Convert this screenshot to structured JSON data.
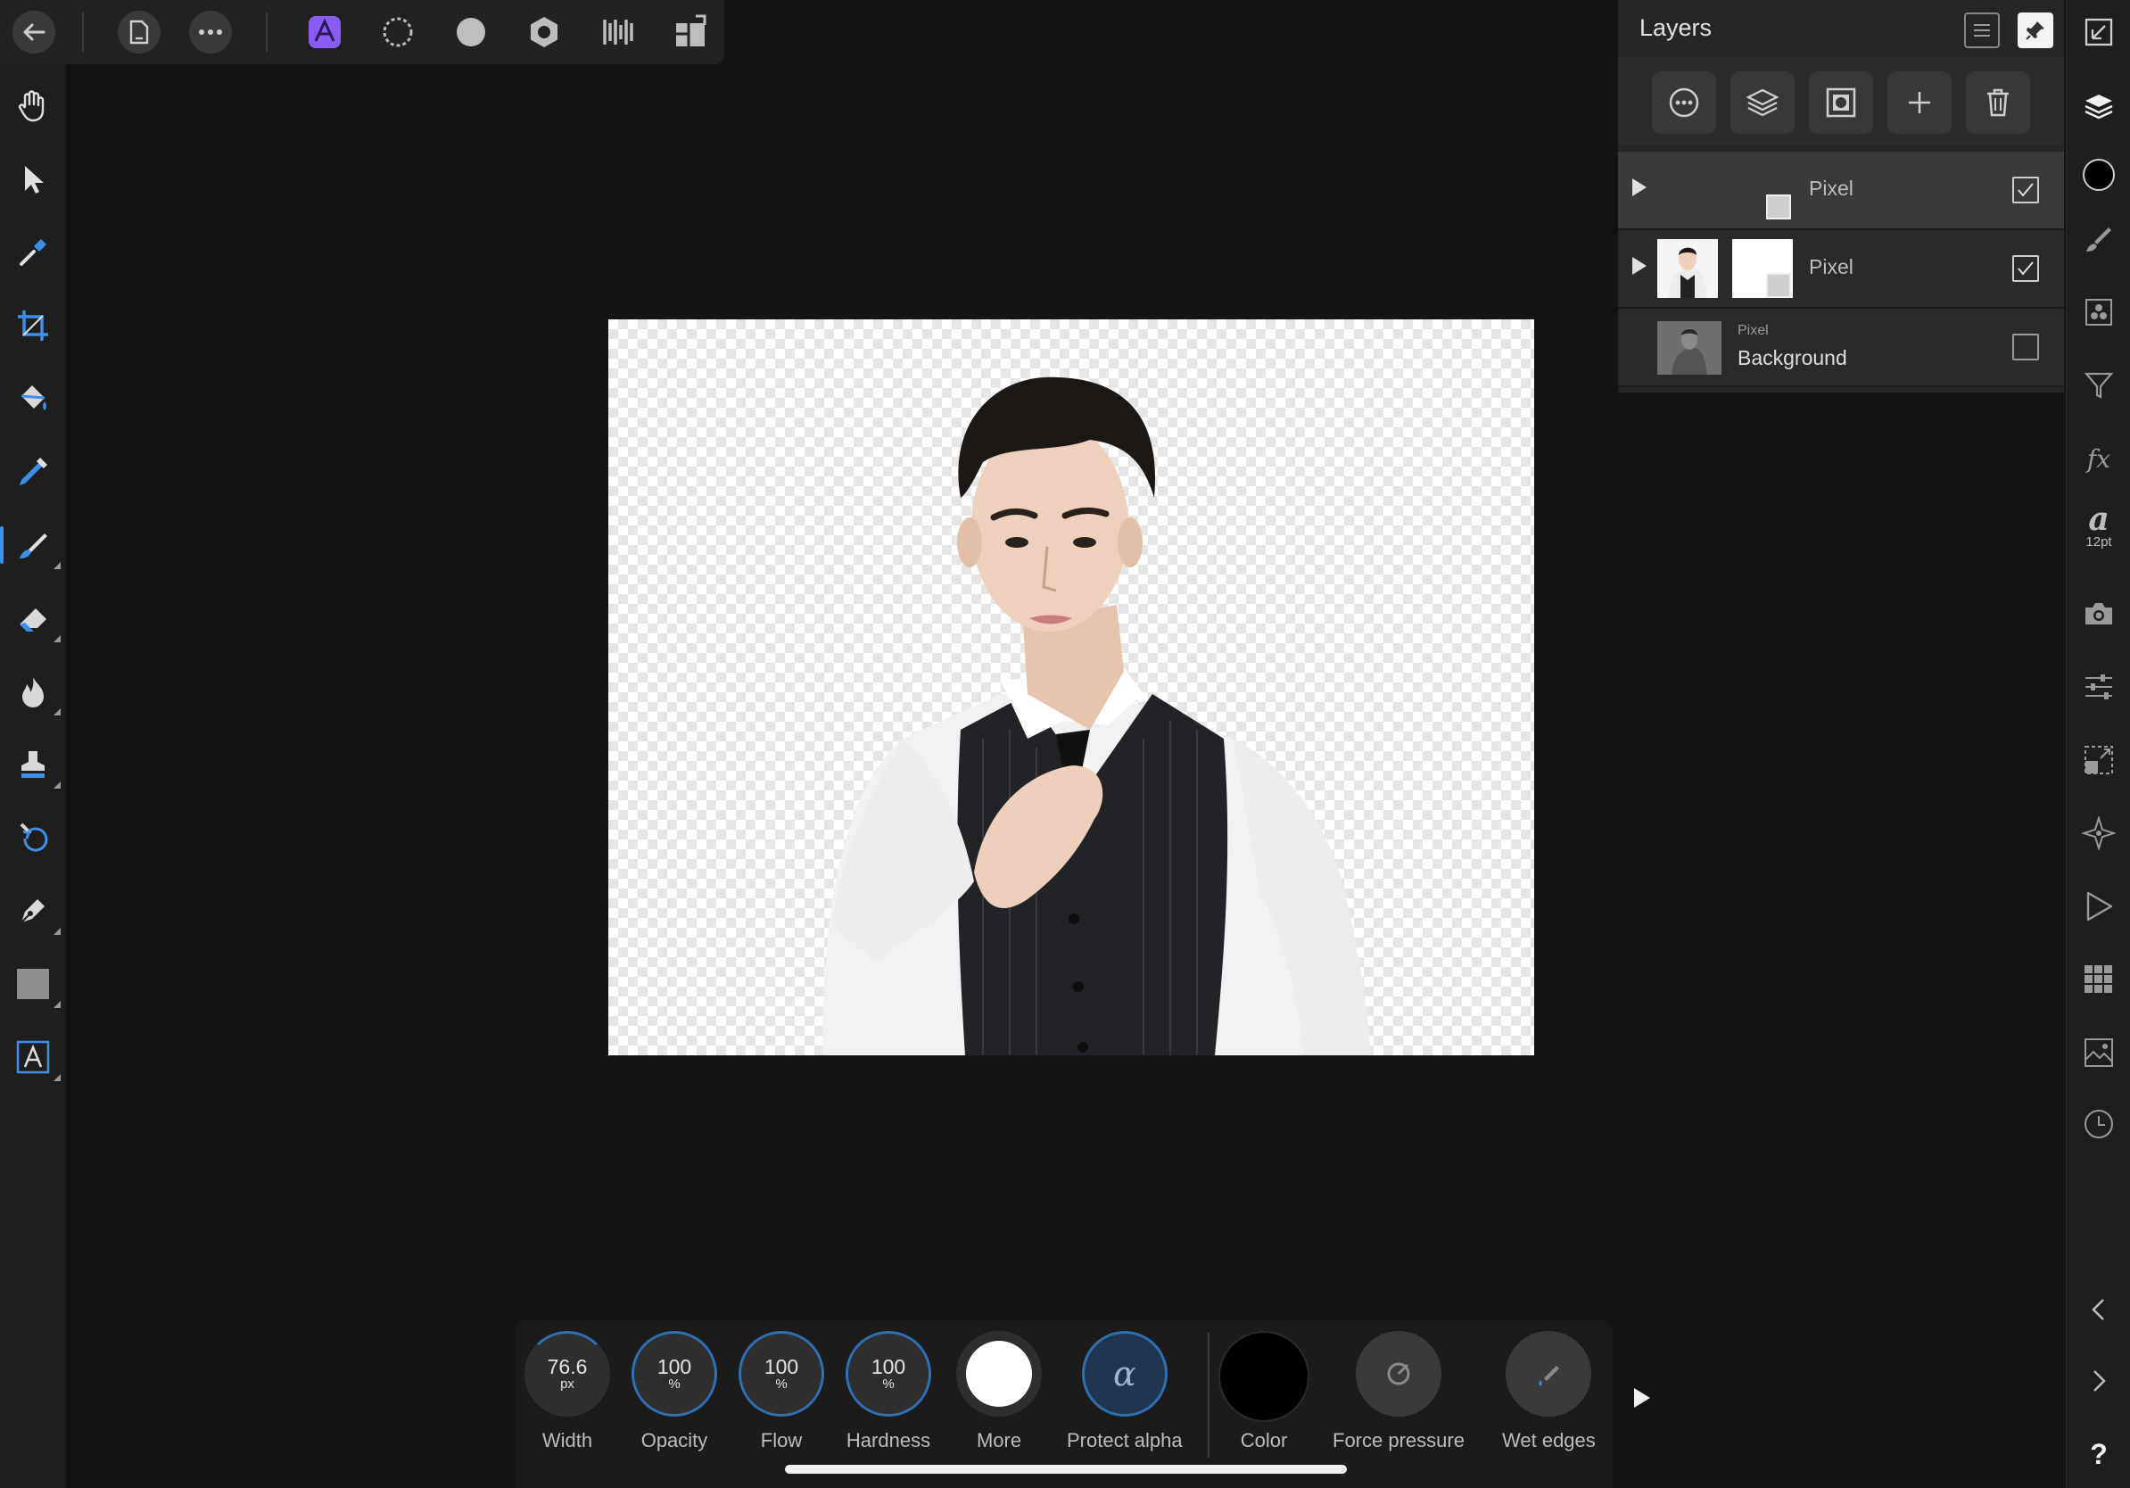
{
  "topbar": {
    "icons": [
      "back-arrow-icon",
      "document-icon",
      "more-dots-icon",
      "photo-persona-icon",
      "liquify-persona-icon",
      "develop-persona-icon",
      "tone-mapping-persona-icon",
      "export-persona-icon",
      "split-view-icon"
    ]
  },
  "tools": [
    "hand-icon",
    "move-icon",
    "color-picker-icon",
    "crop-icon",
    "flood-fill-icon",
    "selection-brush-icon",
    "paint-brush-icon",
    "erase-brush-icon",
    "dodge-burn-icon",
    "clone-stamp-icon",
    "undo-brush-icon",
    "pen-icon",
    "shape-icon",
    "text-icon"
  ],
  "layers": {
    "title": "Layers",
    "rows": [
      {
        "name": "Pixel",
        "visible": true,
        "selected": true
      },
      {
        "name": "Pixel",
        "visible": true,
        "selected": false
      },
      {
        "type_label": "Pixel",
        "name": "Background",
        "visible": false,
        "selected": false
      }
    ]
  },
  "studio": {
    "text_size": "12pt",
    "text_glyph": "a",
    "fx_glyph": "fx",
    "help_glyph": "?"
  },
  "context": {
    "width": {
      "value": "76.6",
      "unit": "px",
      "label": "Width"
    },
    "opacity": {
      "value": "100",
      "unit": "%",
      "label": "Opacity"
    },
    "flow": {
      "value": "100",
      "unit": "%",
      "label": "Flow"
    },
    "hardness": {
      "value": "100",
      "unit": "%",
      "label": "Hardness"
    },
    "more": {
      "label": "More"
    },
    "protect_alpha": {
      "label": "Protect alpha",
      "glyph": "α"
    },
    "color": {
      "label": "Color",
      "value": "#000000"
    },
    "force_pressure": {
      "label": "Force pressure"
    },
    "wet_edges": {
      "label": "Wet edges"
    }
  },
  "colors": {
    "accent": "#3d8fe8",
    "persona": "#8a5cf6"
  }
}
